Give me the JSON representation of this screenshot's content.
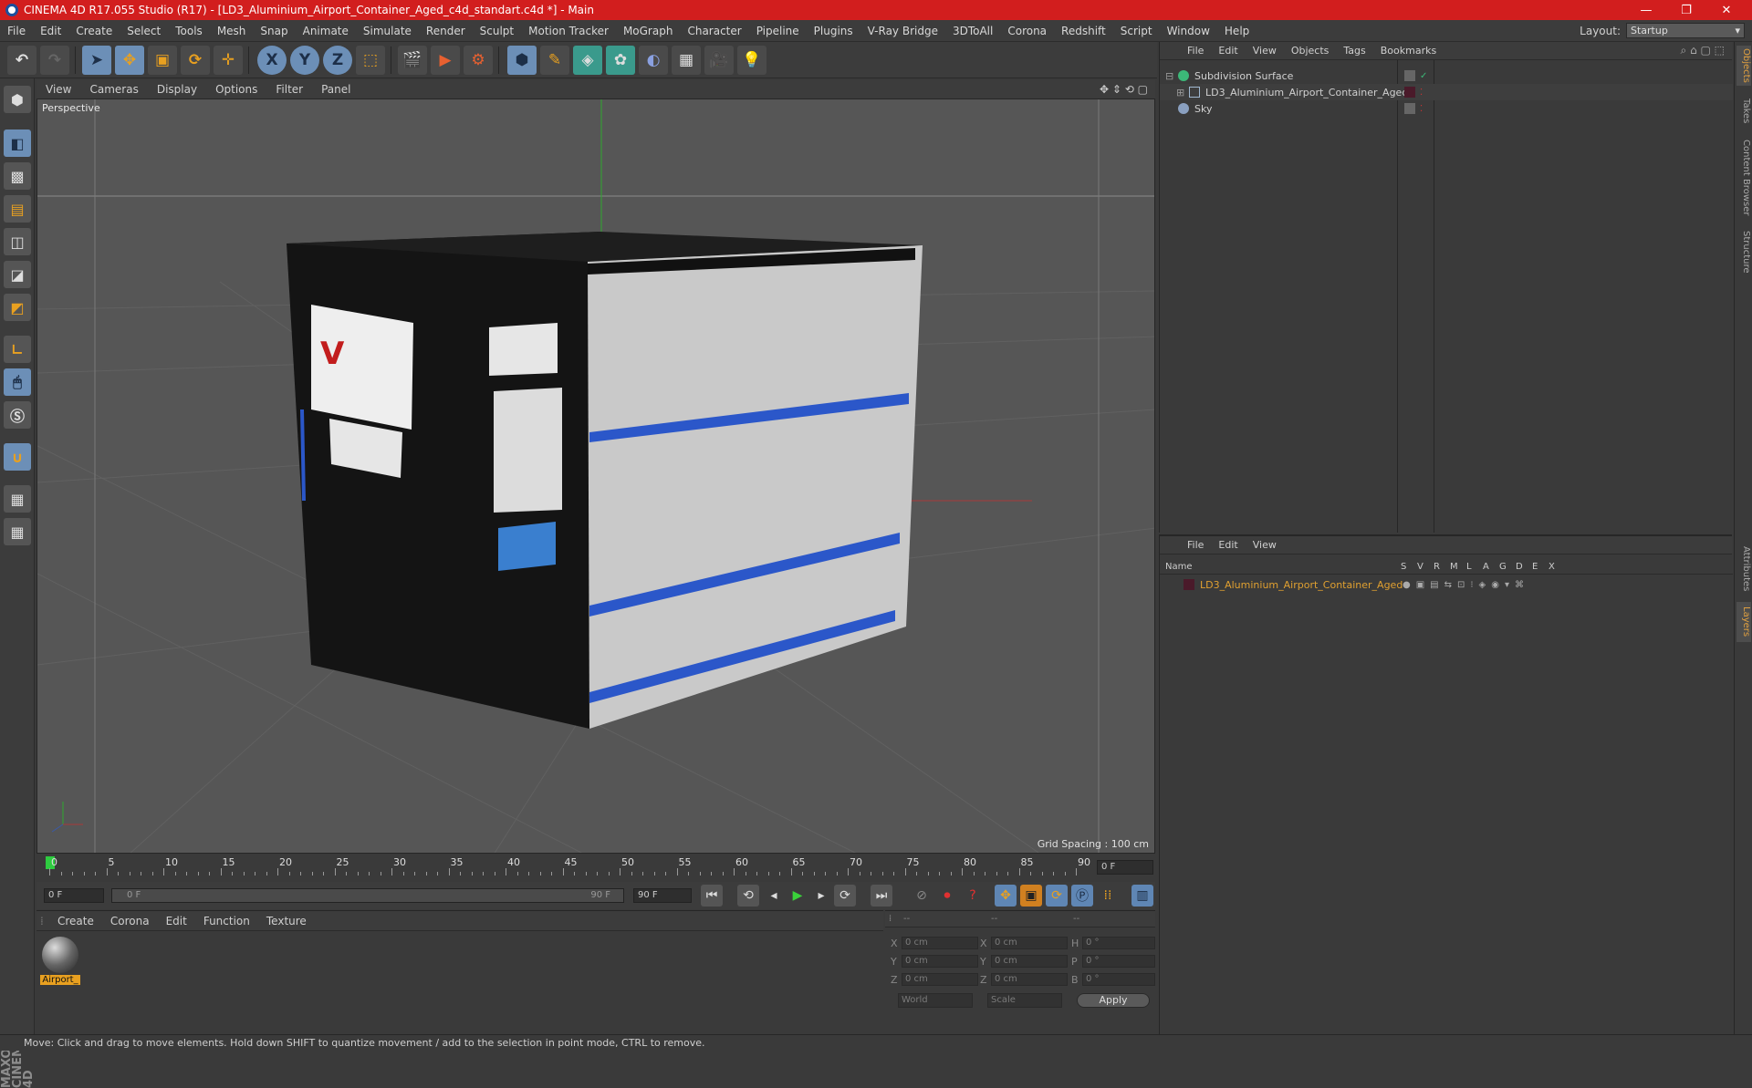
{
  "window": {
    "title": "CINEMA 4D R17.055 Studio (R17) - [LD3_Aluminium_Airport_Container_Aged_c4d_standart.c4d *] - Main",
    "controls": [
      "—",
      "❐",
      "✕"
    ]
  },
  "menubar": [
    "File",
    "Edit",
    "Create",
    "Select",
    "Tools",
    "Mesh",
    "Snap",
    "Animate",
    "Simulate",
    "Render",
    "Sculpt",
    "Motion Tracker",
    "MoGraph",
    "Character",
    "Pipeline",
    "Plugins",
    "V-Ray Bridge",
    "3DToAll",
    "Corona",
    "Redshift",
    "Script",
    "Window",
    "Help"
  ],
  "layout": {
    "label": "Layout:",
    "value": "Startup"
  },
  "toolbar": {
    "axis_x": "X",
    "axis_y": "Y",
    "axis_z": "Z"
  },
  "viewport": {
    "menu": [
      "View",
      "Cameras",
      "Display",
      "Options",
      "Filter",
      "Panel"
    ],
    "label": "Perspective",
    "grid_spacing": "Grid Spacing : 100 cm"
  },
  "timeline": {
    "ticks": [
      "0",
      "5",
      "10",
      "15",
      "20",
      "25",
      "30",
      "35",
      "40",
      "45",
      "50",
      "55",
      "60",
      "65",
      "70",
      "75",
      "80",
      "85",
      "90"
    ],
    "current_frame": "0 F",
    "start": "0 F",
    "range_start": "0 F",
    "range_end": "90 F",
    "end": "90 F"
  },
  "material": {
    "menu": [
      "Create",
      "Corona",
      "Edit",
      "Function",
      "Texture"
    ],
    "items": [
      {
        "name": "Airport_"
      }
    ]
  },
  "coords": {
    "header": [
      "--",
      "--",
      "--"
    ],
    "rows": [
      {
        "a": "X",
        "av": "0 cm",
        "b": "X",
        "bv": "0 cm",
        "c": "H",
        "cv": "0 °"
      },
      {
        "a": "Y",
        "av": "0 cm",
        "b": "Y",
        "bv": "0 cm",
        "c": "P",
        "cv": "0 °"
      },
      {
        "a": "Z",
        "av": "0 cm",
        "b": "Z",
        "bv": "0 cm",
        "c": "B",
        "cv": "0 °"
      }
    ],
    "world": "World",
    "scale": "Scale",
    "apply": "Apply"
  },
  "objects": {
    "menu": [
      "File",
      "Edit",
      "View",
      "Objects",
      "Tags",
      "Bookmarks"
    ],
    "items": [
      {
        "name": "Subdivision Surface",
        "color": "#3cb878"
      },
      {
        "name": "LD3_Aluminium_Airport_Container_Aged",
        "color": "#a0b8d0"
      },
      {
        "name": "Sky",
        "color": "#8aa0c0"
      }
    ]
  },
  "layers": {
    "menu": [
      "File",
      "Edit",
      "View"
    ],
    "col_name": "Name",
    "cols": [
      "S",
      "V",
      "R",
      "M",
      "L",
      "A",
      "G",
      "D",
      "E",
      "X"
    ],
    "items": [
      {
        "name": "LD3_Aluminium_Airport_Container_Aged",
        "color": "#e0a030"
      }
    ]
  },
  "right_tabs": [
    "Objects",
    "Takes",
    "Content Browser",
    "Structure",
    "Attributes",
    "Layers"
  ],
  "status": "Move: Click and drag to move elements. Hold down SHIFT to quantize movement / add to the selection in point mode, CTRL to remove.",
  "maxon": "MAXON CINEMA 4D"
}
